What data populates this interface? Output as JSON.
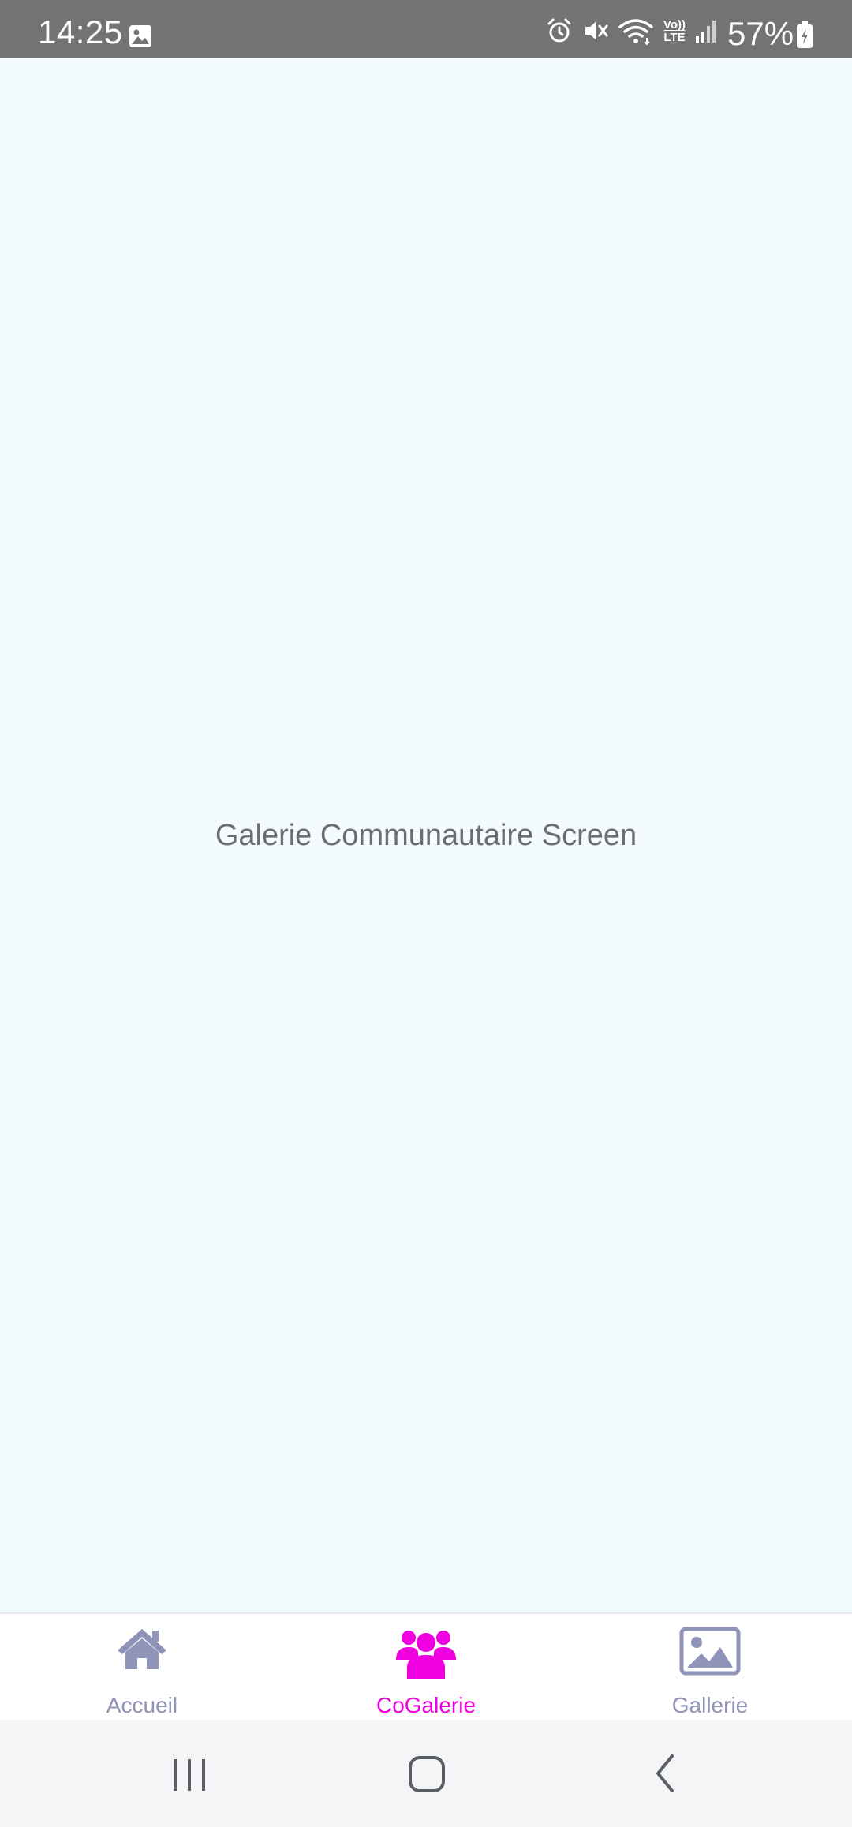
{
  "status_bar": {
    "time": "14:25",
    "battery_percent": "57%",
    "icons": [
      "gallery-icon",
      "alarm-icon",
      "mute-icon",
      "wifi-icon",
      "volte-icon",
      "signal-icon",
      "battery-icon"
    ],
    "volte_label_top": "Vo))",
    "volte_label_bottom": "LTE"
  },
  "main": {
    "title": "Galerie Communautaire Screen"
  },
  "tabs": [
    {
      "label": "Accueil",
      "icon": "home-icon",
      "active": false
    },
    {
      "label": "CoGalerie",
      "icon": "users-icon",
      "active": true
    },
    {
      "label": "Gallerie",
      "icon": "image-icon",
      "active": false
    }
  ],
  "colors": {
    "status_bar_bg": "#737373",
    "content_bg": "#f3fbff",
    "tab_inactive": "#8f94b8",
    "tab_active": "#f000e0",
    "title_text": "#6b6e73"
  },
  "nav_bar": {
    "buttons": [
      "recent-apps-icon",
      "home-button-icon",
      "back-icon"
    ]
  }
}
